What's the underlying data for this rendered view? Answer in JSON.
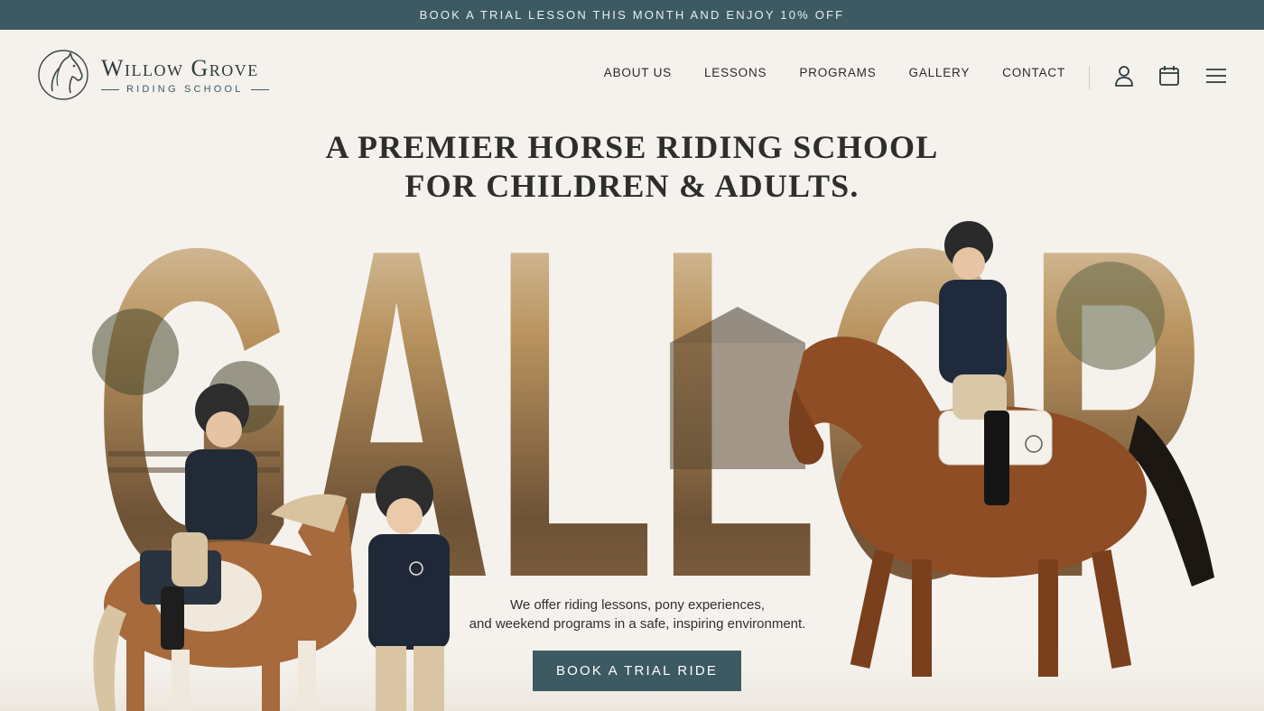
{
  "promo_bar": {
    "text": "BOOK A TRIAL LESSON THIS MONTH AND ENJOY 10% OFF"
  },
  "brand": {
    "name": "Willow Grove",
    "tagline": "RIDING SCHOOL"
  },
  "nav": {
    "items": [
      {
        "label": "ABOUT US"
      },
      {
        "label": "LESSONS"
      },
      {
        "label": "PROGRAMS"
      },
      {
        "label": "GALLERY"
      },
      {
        "label": "CONTACT"
      }
    ],
    "icons": [
      "user-icon",
      "calendar-icon",
      "menu-icon"
    ]
  },
  "hero": {
    "headline_line1": "A PREMIER HORSE RIDING SCHOOL",
    "headline_line2": "FOR CHILDREN & ADULTS.",
    "big_word": "GALLOP",
    "description_line1": "We offer riding lessons, pony experiences,",
    "description_line2": "and weekend programs in a safe, inspiring environment.",
    "cta_label": "BOOK A TRIAL RIDE"
  },
  "colors": {
    "accent": "#3d5a63",
    "background": "#f5f2ed",
    "text": "#2b2b2b"
  }
}
